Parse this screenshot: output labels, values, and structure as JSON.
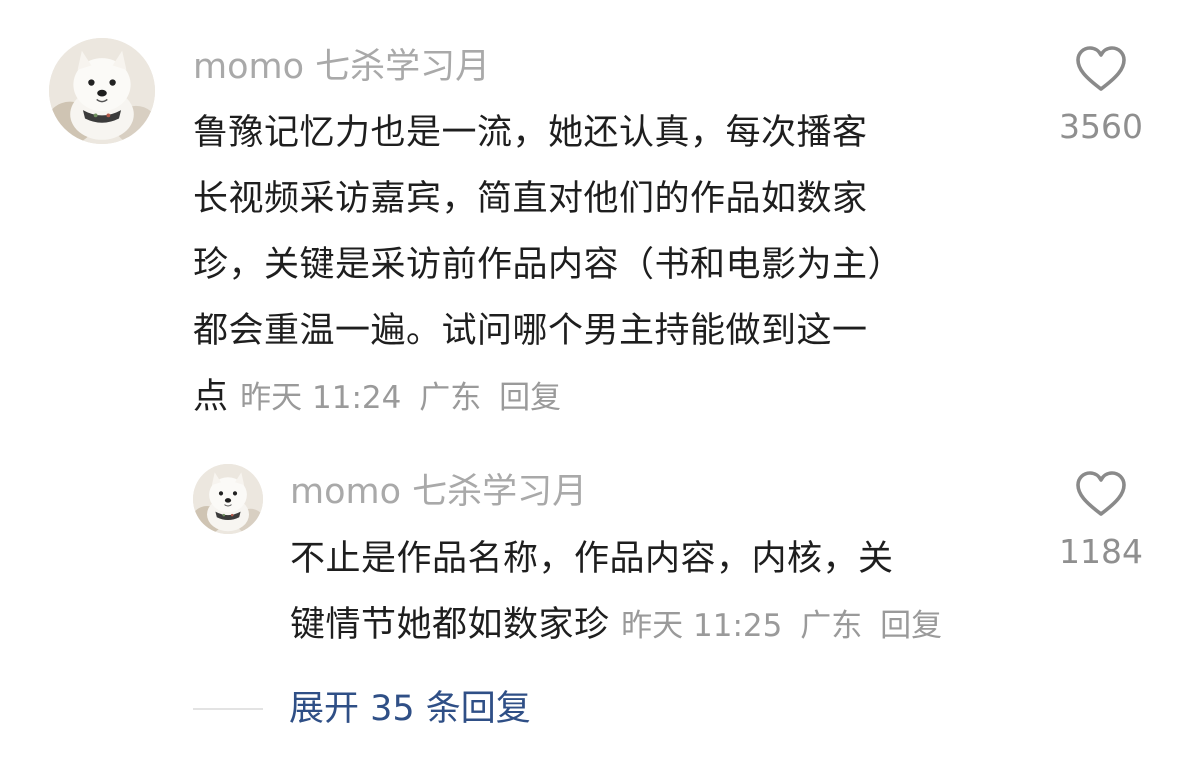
{
  "comments": [
    {
      "username": "momo 七杀学习月",
      "lines": [
        "鲁豫记忆力也是一流，她还认真，每次播客",
        "长视频采访嘉宾，简直对他们的作品如数家",
        "珍，关键是采访前作品内容（书和电影为主）",
        "都会重温一遍。试问哪个男主持能做到这一"
      ],
      "last_line": "点",
      "time": "昨天 11:24",
      "location": "广东",
      "reply_label": "回复",
      "like_count": "3560"
    },
    {
      "username": "momo 七杀学习月",
      "lines": [
        "不止是作品名称，作品内容，内核，关"
      ],
      "last_line": "键情节她都如数家珍",
      "time": "昨天 11:25",
      "location": "广东",
      "reply_label": "回复",
      "like_count": "1184"
    }
  ],
  "expand_label": "展开 35 条回复",
  "icons": {
    "like": "heart-outline-icon",
    "avatar": "samoyed-dog-avatar"
  },
  "colors": {
    "username": "#a9a9a9",
    "meta": "#9a9a9a",
    "link": "#2f4f86",
    "heart": "#8a8a8a"
  }
}
